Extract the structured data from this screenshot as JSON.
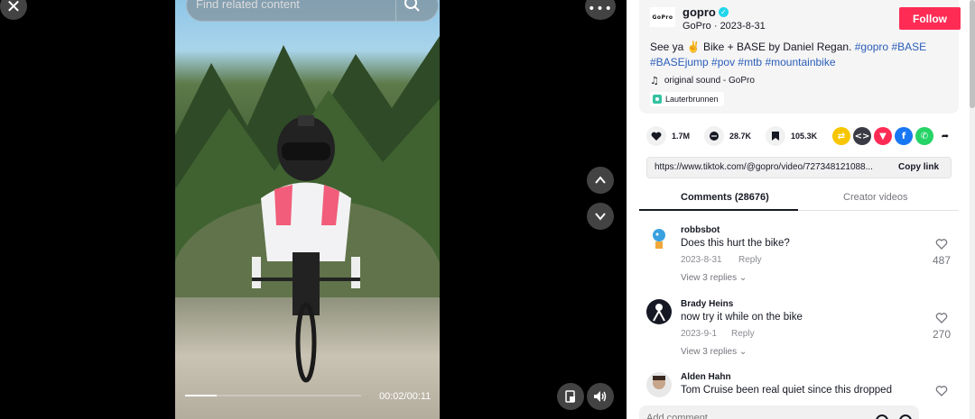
{
  "search": {
    "placeholder": "Find related content"
  },
  "video": {
    "time": "00:02/00:11",
    "progress": 0.18
  },
  "author": {
    "avatar_text": "GoPro",
    "name": "gopro",
    "sub": "GoPro · 2023-8-31",
    "follow_label": "Follow"
  },
  "caption": {
    "text": "See ya ✌️ Bike + BASE by Daniel Regan. ",
    "tags": [
      "#gopro",
      "#BASE",
      "#BASEjump",
      "#pov",
      "#mtb",
      "#mountainbike"
    ],
    "music": "original sound - GoPro",
    "location": "Lauterbrunnen"
  },
  "actions": {
    "likes": "1.7M",
    "comments": "28.7K",
    "saves": "105.3K"
  },
  "link": {
    "url": "https://www.tiktok.com/@gopro/video/727348121088...",
    "copy_label": "Copy link"
  },
  "tabs": {
    "comments": "Comments (28676)",
    "creator": "Creator videos"
  },
  "comments": [
    {
      "name": "robbsbot",
      "text": "Does this hurt the bike?",
      "date": "2023-8-31",
      "reply": "Reply",
      "view": "View 3 replies ⌄",
      "likes": "487"
    },
    {
      "name": "Brady Heins",
      "text": "now try it while on the bike",
      "date": "2023-9-1",
      "reply": "Reply",
      "view": "View 3 replies ⌄",
      "likes": "270"
    },
    {
      "name": "Alden Hahn",
      "text": "Tom Cruise been real quiet since this dropped",
      "date": "",
      "reply": "",
      "view": "",
      "likes": ""
    }
  ],
  "comment_input": {
    "placeholder": "Add comment..."
  },
  "colors": {
    "follow": "#fe2c55",
    "hashtag": "#2b5db9",
    "verified": "#20d5ec"
  },
  "icons": [
    "close-icon",
    "more-icon",
    "search-icon",
    "chevron-up-icon",
    "chevron-down-icon",
    "pip-icon",
    "volume-icon",
    "heart-icon",
    "comment-icon",
    "bookmark-icon",
    "music-icon",
    "location-icon"
  ]
}
